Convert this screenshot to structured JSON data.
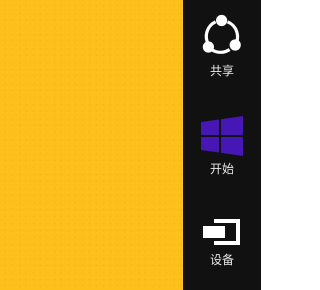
{
  "colors": {
    "desktop_background": "#FDBF1A",
    "charms_background": "#111111",
    "charm_icon": "#FFFFFF",
    "start_logo": "#4617B4",
    "label_text": "#E6E6E6"
  },
  "charms": {
    "share": {
      "label": "共享",
      "icon": "share-icon"
    },
    "start": {
      "label": "开始",
      "icon": "windows-logo-icon"
    },
    "devices": {
      "label": "设备",
      "icon": "devices-icon"
    }
  }
}
